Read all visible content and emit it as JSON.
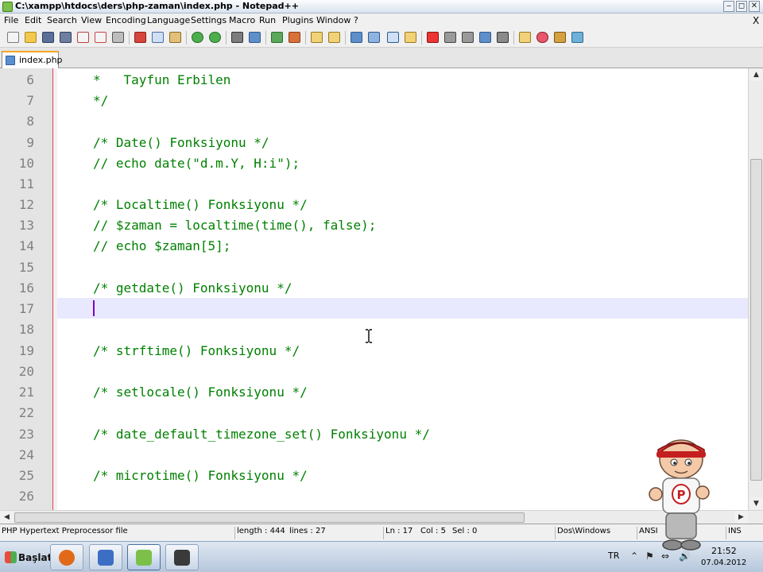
{
  "window": {
    "title": "C:\\xampp\\htdocs\\ders\\php-zaman\\index.php - Notepad++",
    "minimize": "‒",
    "maximize": "◻",
    "close": "✕"
  },
  "menu": {
    "items": [
      "File",
      "Edit",
      "Search",
      "View",
      "Encoding",
      "Language",
      "Settings",
      "Macro",
      "Run",
      "Plugins",
      "Window",
      "?"
    ],
    "close_doc": "X"
  },
  "tabs": [
    {
      "label": "index.php"
    }
  ],
  "editor": {
    "lines": [
      {
        "num": "6",
        "text": "*   Tayfun Erbilen"
      },
      {
        "num": "7",
        "text": "*/"
      },
      {
        "num": "8",
        "text": ""
      },
      {
        "num": "9",
        "text": "/* Date() Fonksiyonu */"
      },
      {
        "num": "10",
        "text": "// echo date(\"d.m.Y, H:i\");"
      },
      {
        "num": "11",
        "text": ""
      },
      {
        "num": "12",
        "text": "/* Localtime() Fonksiyonu */"
      },
      {
        "num": "13",
        "text": "// $zaman = localtime(time(), false);"
      },
      {
        "num": "14",
        "text": "// echo $zaman[5];"
      },
      {
        "num": "15",
        "text": ""
      },
      {
        "num": "16",
        "text": "/* getdate() Fonksiyonu */"
      },
      {
        "num": "17",
        "text": ""
      },
      {
        "num": "18",
        "text": ""
      },
      {
        "num": "19",
        "text": "/* strftime() Fonksiyonu */"
      },
      {
        "num": "20",
        "text": ""
      },
      {
        "num": "21",
        "text": "/* setlocale() Fonksiyonu */"
      },
      {
        "num": "22",
        "text": ""
      },
      {
        "num": "23",
        "text": "/* date_default_timezone_set() Fonksiyonu */"
      },
      {
        "num": "24",
        "text": ""
      },
      {
        "num": "25",
        "text": "/* microtime() Fonksiyonu */"
      },
      {
        "num": "26",
        "text": ""
      }
    ],
    "current_line": "17",
    "text_color": "#008000",
    "current_line_color": "#e8e8ff"
  },
  "scrollbars": {
    "up": "▲",
    "down": "▼",
    "left": "◀",
    "right": "▶"
  },
  "status": {
    "file_type": "PHP Hypertext Preprocessor file",
    "length": "length : 444",
    "lines": "lines : 27",
    "ln": "Ln : 17",
    "col": "Col : 5",
    "sel": "Sel : 0",
    "eol": "Dos\\Windows",
    "encoding": "ANSI",
    "mode": "INS"
  },
  "taskbar": {
    "start_label": "Başlat",
    "apps": [
      {
        "name": "firefox",
        "color": "#e06a1a"
      },
      {
        "name": "file-manager",
        "color": "#3c6fc4"
      },
      {
        "name": "notepad-plus-plus",
        "color": "#7cc04a"
      },
      {
        "name": "video-recorder",
        "color": "#3a3a3a"
      }
    ],
    "language": "TR",
    "tray_icons": [
      "⌃",
      "⚑",
      "⇔",
      "🔊"
    ],
    "time": "21:52",
    "date": "07.04.2012"
  },
  "mascot": {
    "shirt_letter": "P"
  }
}
